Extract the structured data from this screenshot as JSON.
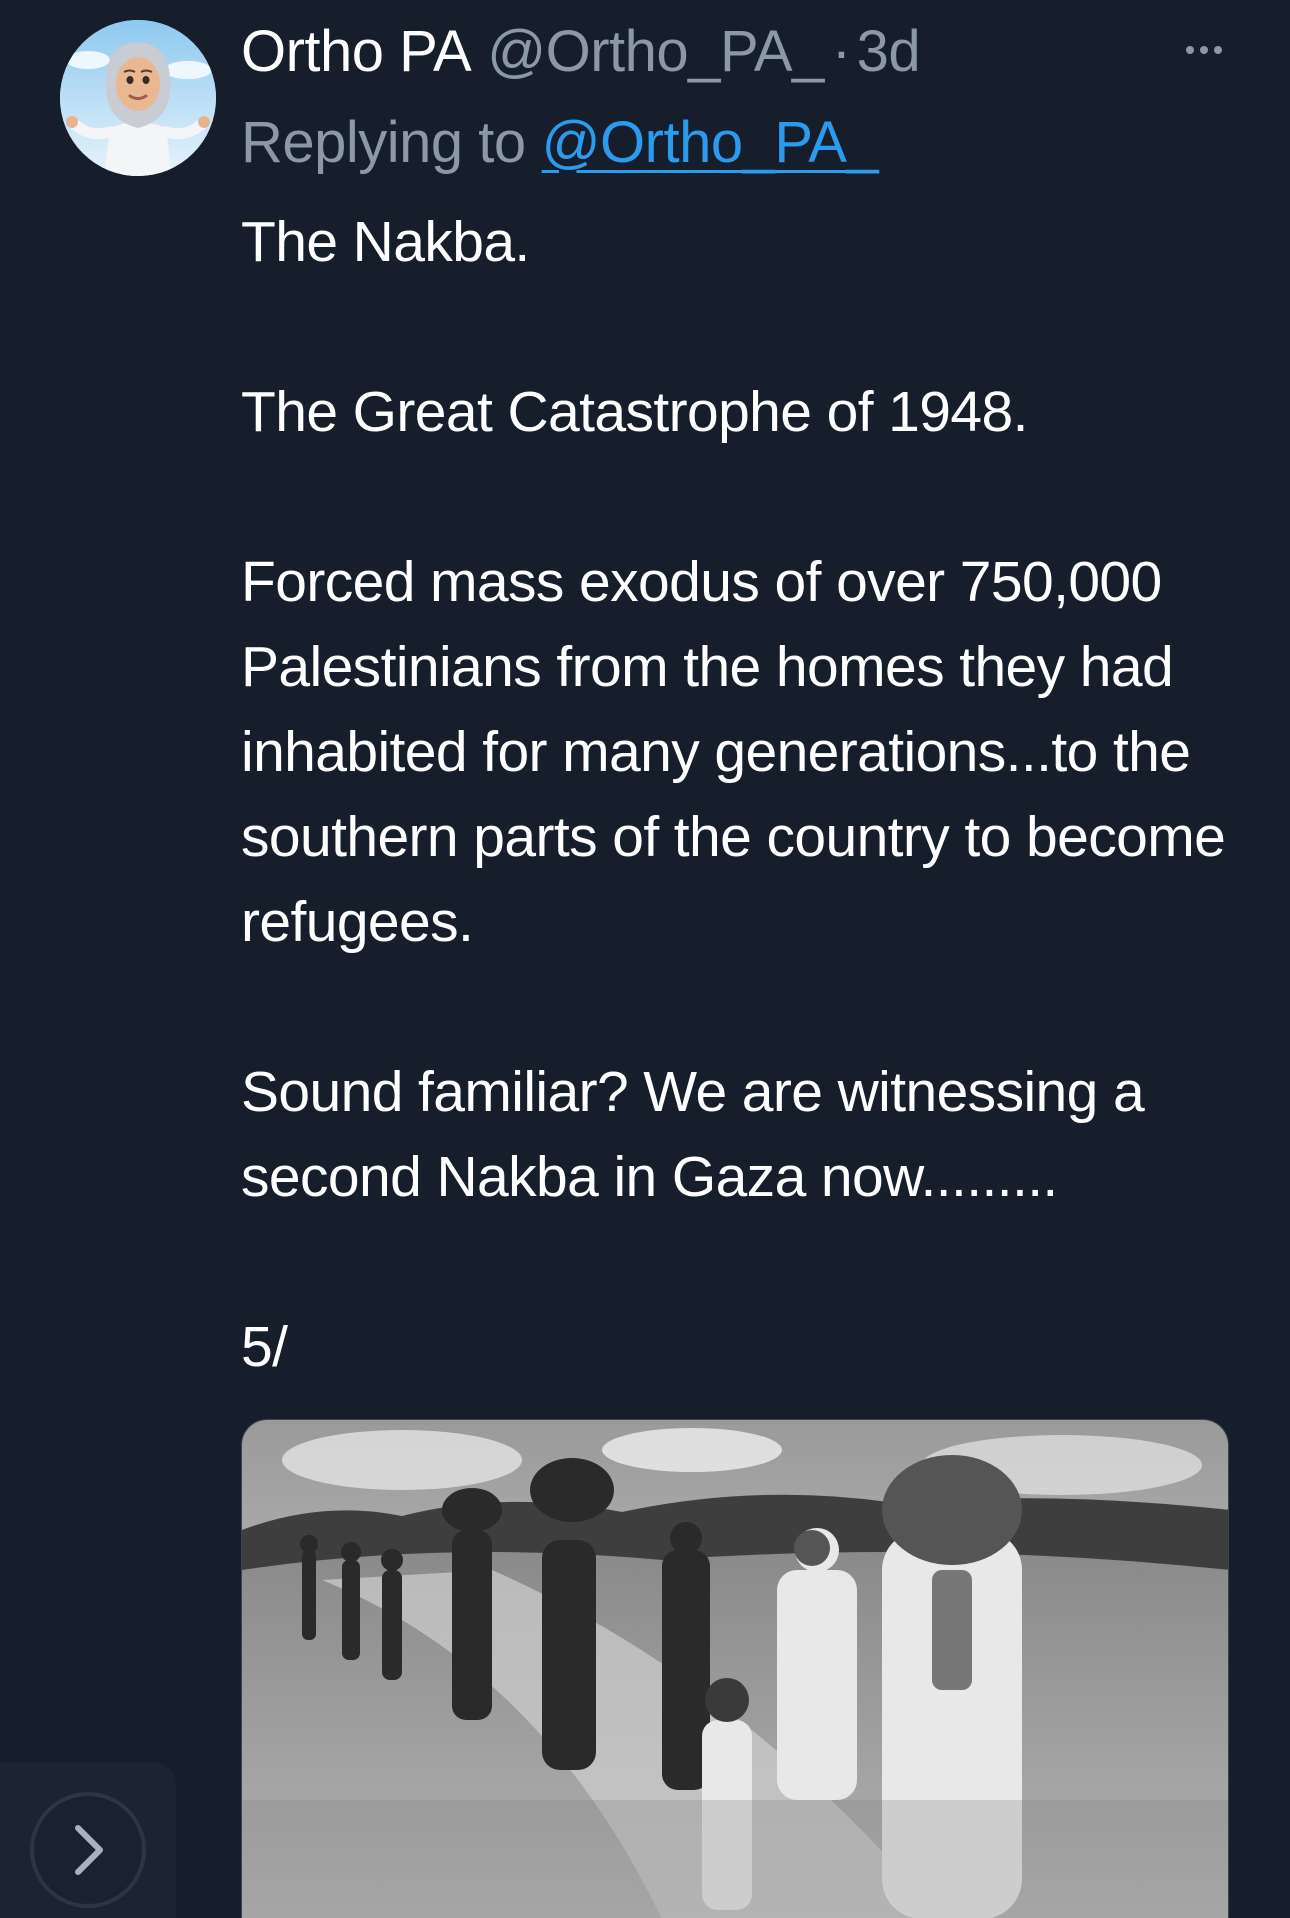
{
  "tweet": {
    "author": {
      "display_name": "Ortho PA",
      "handle": "@Ortho_PA_",
      "separator": "·",
      "timestamp": "3d",
      "avatar_icon": "avatar-cartoon-icon"
    },
    "reply": {
      "prefix": "Replying to",
      "target": "@Ortho_PA_"
    },
    "paragraphs": [
      "The Nakba.",
      "The Great Catastrophe of 1948.",
      "Forced mass exodus of over 750,000 Palestinians from the homes they had inhabited for many generations...to the southern parts of the country to become refugees.",
      "Sound familiar? We are witnessing a second Nakba in Gaza now.........",
      "5/"
    ],
    "media": {
      "kind": "black-and-white photograph",
      "icon": "photo-icon"
    },
    "more_icon": "more-options-icon",
    "next_icon": "chevron-right-icon"
  },
  "colors": {
    "background": "#161e2b",
    "primary_text": "#ffffff",
    "secondary_text": "#8b98a7",
    "link": "#2b9bf0"
  }
}
